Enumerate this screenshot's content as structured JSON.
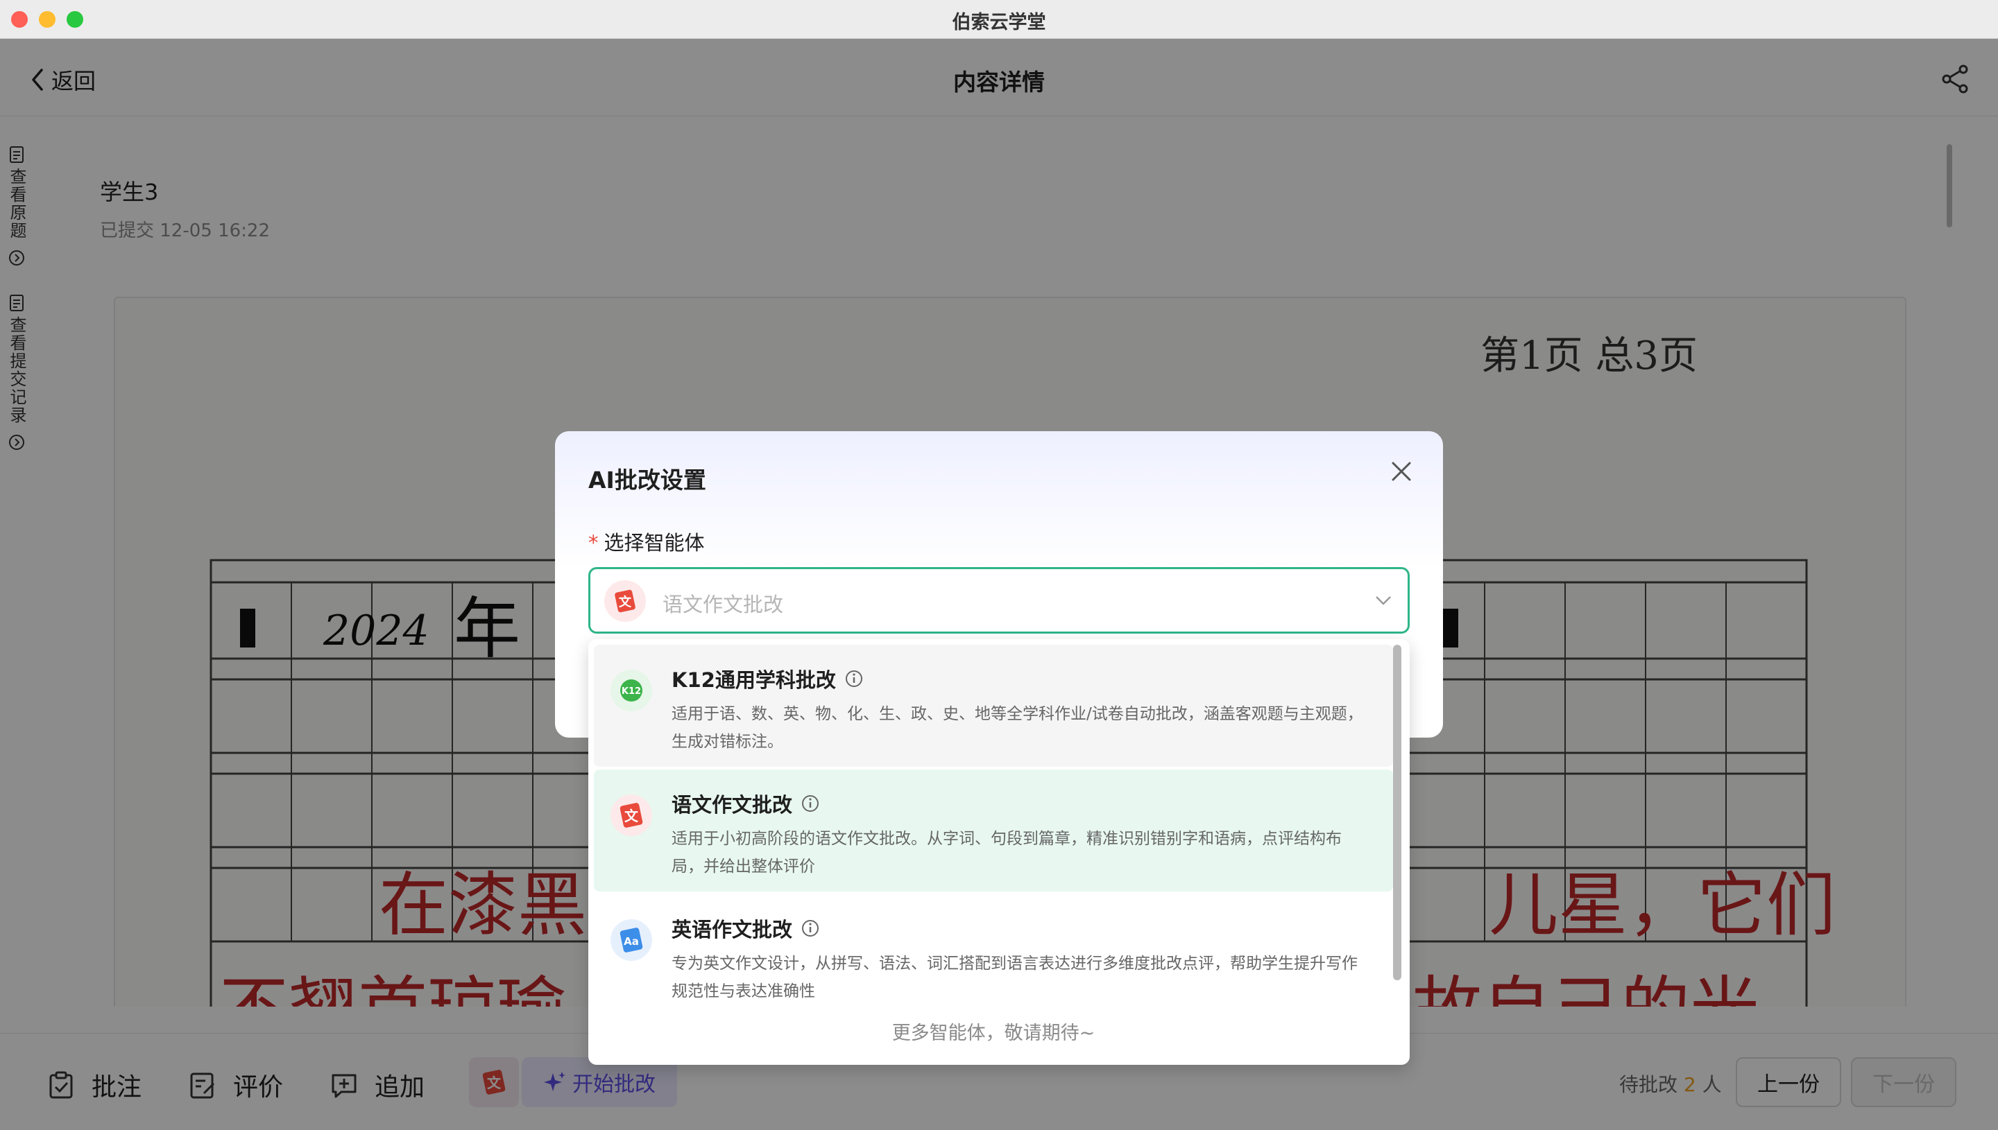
{
  "window": {
    "title": "伯索云学堂"
  },
  "topbar": {
    "back_label": "返回",
    "title": "内容详情"
  },
  "leftrail": {
    "items": [
      {
        "label": "查看原题"
      },
      {
        "label": "查看提交记录"
      }
    ]
  },
  "content": {
    "student_name": "学生3",
    "submit_time": "已提交 12-05 16:22",
    "page_indicator": "第1页 总3页",
    "handwriting_year": "2024",
    "handwriting_year_char": "年",
    "handwriting_line1": "在漆黑",
    "handwriting_line1_end": "儿星，它们",
    "handwriting_line2": "不翘首琼瑜",
    "handwriting_line2_end": "故自己的光"
  },
  "bottombar": {
    "annotate_label": "批注",
    "evaluate_label": "评价",
    "append_label": "追加",
    "start_label": "开始批改",
    "pending_prefix": "待批改",
    "pending_count": "2",
    "pending_suffix": "人",
    "prev_label": "上一份",
    "next_label": "下一份"
  },
  "modal": {
    "title": "AI批改设置",
    "field_label": "选择智能体",
    "required_mark": "*",
    "select_placeholder": "语文作文批改",
    "options": [
      {
        "title": "K12通用学科批改",
        "icon_text": "K12",
        "icon_color": "#3cb44b",
        "desc": "适用于语、数、英、物、化、生、政、史、地等全学科作业/试卷自动批改，涵盖客观题与主观题，生成对错标注。"
      },
      {
        "title": "语文作文批改",
        "icon_text": "文",
        "icon_color": "#e84a3c",
        "desc": "适用于小初高阶段的语文作文批改。从字词、句段到篇章，精准识别错别字和语病，点评结构布局，并给出整体评价"
      },
      {
        "title": "英语作文批改",
        "icon_text": "Aa",
        "icon_color": "#3d8ee8",
        "desc": "专为英文作文设计，从拼写、语法、词汇搭配到语言表达进行多维度批改点评，帮助学生提升写作规范性与表达准确性"
      }
    ],
    "footer": "更多智能体，敬请期待~"
  }
}
